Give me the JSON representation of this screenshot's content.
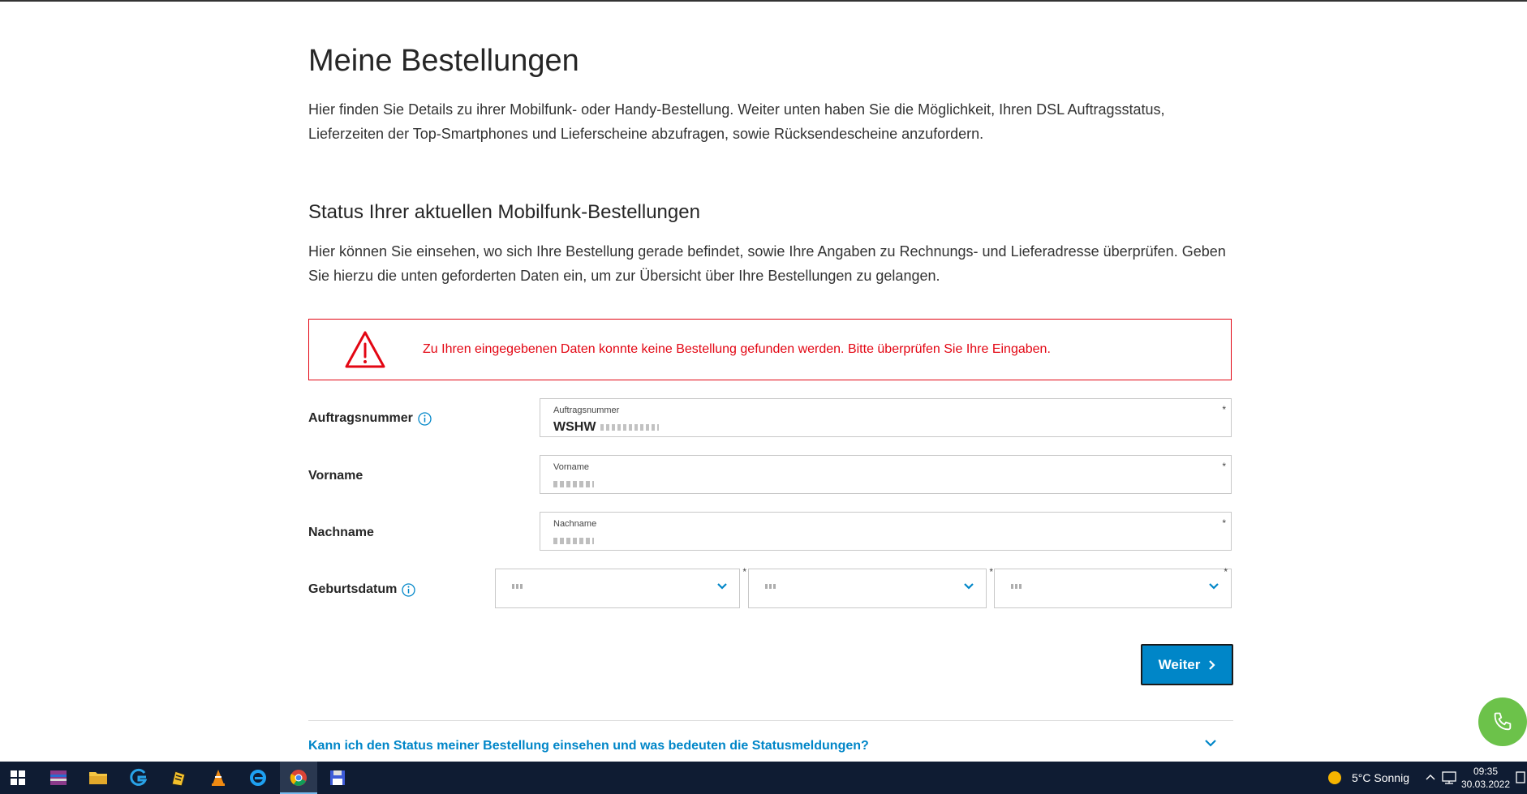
{
  "page": {
    "title": "Meine Bestellungen",
    "intro": "Hier finden Sie Details zu ihrer Mobilfunk- oder Handy-Bestellung. Weiter unten haben Sie die Möglichkeit, Ihren DSL Auftragsstatus, Lieferzeiten der Top-Smartphones und Lieferscheine abzufragen, sowie Rücksendescheine anzufordern.",
    "section_title": "Status Ihrer aktuellen Mobilfunk-Bestellungen",
    "section_text": "Hier können Sie einsehen, wo sich Ihre Bestellung gerade befindet, sowie Ihre Angaben zu Rechnungs- und Lieferadresse überprüfen. Geben Sie hierzu die unten geforderten Daten ein, um zur Übersicht über Ihre Bestellungen zu gelangen."
  },
  "alert": {
    "message": "Zu Ihren eingegebenen Daten konnte keine Bestellung gefunden werden. Bitte überprüfen Sie Ihre Eingaben.",
    "color": "#e30613"
  },
  "form": {
    "order_number": {
      "row_label": "Auftragsnummer",
      "field_label": "Auftragsnummer",
      "value": "WSHW",
      "required": "*"
    },
    "first_name": {
      "row_label": "Vorname",
      "field_label": "Vorname",
      "required": "*"
    },
    "last_name": {
      "row_label": "Nachname",
      "field_label": "Nachname",
      "required": "*"
    },
    "birthdate": {
      "row_label": "Geburtsdatum",
      "required": "*"
    },
    "submit_label": "Weiter"
  },
  "faq": {
    "question": "Kann ich den Status meiner Bestellung einsehen und was bedeuten die Statusmeldungen?"
  },
  "colors": {
    "accent": "#0086c8",
    "fab": "#6cc24a",
    "taskbar": "#0f1c33"
  },
  "taskbar": {
    "weather": "5°C  Sonnig",
    "time": "09:35",
    "date": "30.03.2022"
  }
}
